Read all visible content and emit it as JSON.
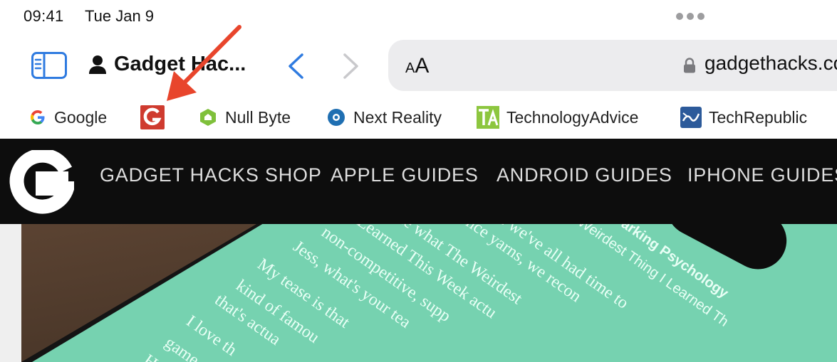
{
  "status_bar": {
    "time": "09:41",
    "date": "Tue Jan 9"
  },
  "toolbar": {
    "tab_group_title": "Gadget Hac...",
    "address": {
      "reader_label_small": "A",
      "reader_label_big": "A",
      "url": "gadgethacks.com"
    }
  },
  "favorites": [
    {
      "label": "Google",
      "icon": "google-icon"
    },
    {
      "label": "",
      "icon": "gadget-hacks-g-icon"
    },
    {
      "label": "Null Byte",
      "icon": "null-byte-icon"
    },
    {
      "label": "Next Reality",
      "icon": "next-reality-icon"
    },
    {
      "label": "TechnologyAdvice",
      "icon": "technology-advice-icon"
    },
    {
      "label": "TechRepublic",
      "icon": "techrepublic-icon"
    }
  ],
  "site": {
    "logo_letter": "G",
    "nav": [
      "GADGET HACKS SHOP",
      "APPLE GUIDES",
      "ANDROID GUIDES",
      "IPHONE GUIDES"
    ]
  },
  "hero_text": {
    "lines": [
      "Parking Psychology",
      "Weirdest Thing I Learned Th",
      "ce we've all had time to",
      "cience yarns, we recon",
      "ide what The Weirdest",
      "Learned This Week actu",
      "non-competitive, supp",
      "Jess, what's your tea",
      "My tease is that",
      "kind of famou",
      "that's actua",
      "I love th",
      "game",
      "Ho"
    ]
  },
  "colors": {
    "arrow": "#e8452c",
    "accent_blue": "#2f7be0",
    "header_bg": "#0d0d0d",
    "hero_green": "#76d2b0"
  }
}
